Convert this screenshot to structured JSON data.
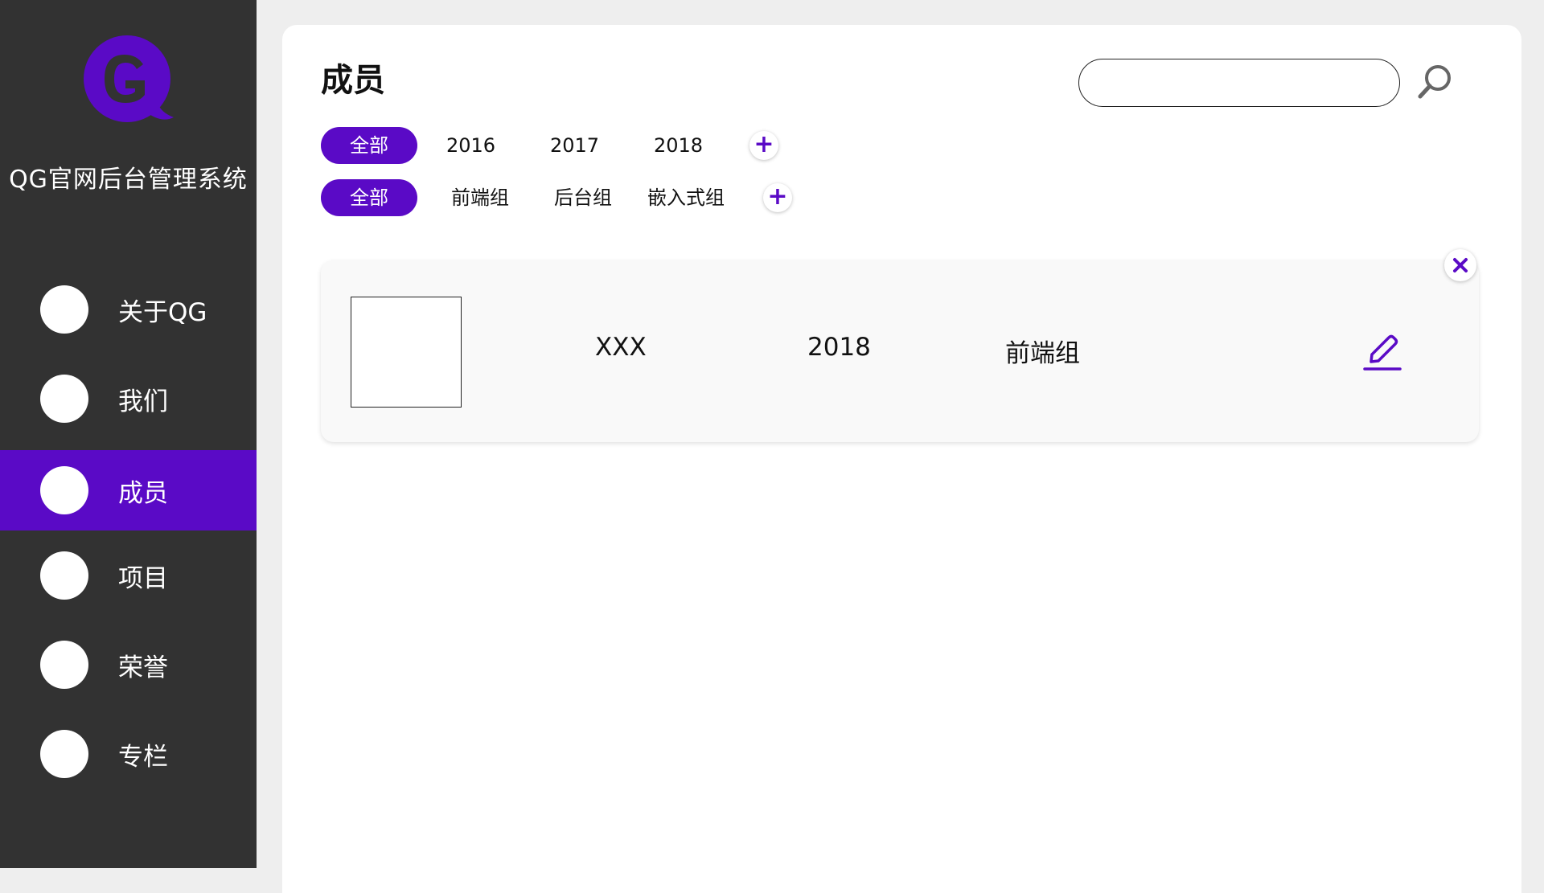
{
  "sidebar": {
    "app_title": "QG官网后台管理系统",
    "logo_icon": "qg-logo-icon",
    "items": [
      {
        "label": "关于QG",
        "active": false
      },
      {
        "label": "我们",
        "active": false
      },
      {
        "label": "成员",
        "active": true
      },
      {
        "label": "项目",
        "active": false
      },
      {
        "label": "荣誉",
        "active": false
      },
      {
        "label": "专栏",
        "active": false
      }
    ]
  },
  "main": {
    "title": "成员",
    "search": {
      "value": "",
      "placeholder": ""
    },
    "year_filters": {
      "all_label": "全部",
      "years": [
        "2016",
        "2017",
        "2018"
      ],
      "add_label": "+"
    },
    "group_filters": {
      "all_label": "全部",
      "groups": [
        "前端组",
        "后台组",
        "嵌入式组"
      ],
      "add_label": "+"
    },
    "members": [
      {
        "name": "XXX",
        "year": "2018",
        "group": "前端组"
      }
    ]
  },
  "colors": {
    "accent": "#5a0ac6",
    "sidebar_bg": "#323232",
    "page_bg": "#eeeeee"
  }
}
